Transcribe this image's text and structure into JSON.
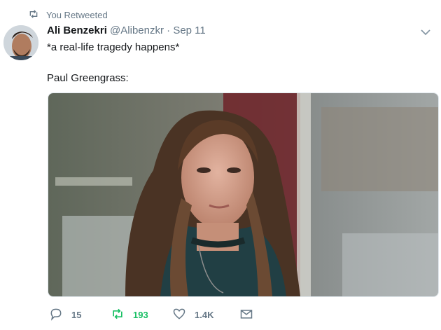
{
  "context": {
    "text": "You Retweeted"
  },
  "tweet": {
    "author_name": "Ali Benzekri",
    "handle": "@Alibenzkr",
    "separator": "·",
    "date": "Sep 11",
    "text_line1": "*a real-life tragedy happens*",
    "text_line2": "Paul Greengrass:"
  },
  "actions": {
    "reply_count": "15",
    "retweet_count": "193",
    "like_count": "1.4K"
  },
  "colors": {
    "retweet_active": "#17bf63",
    "secondary_text": "#657786"
  },
  "icons": [
    "retweet-icon",
    "chevron-down-icon",
    "reply-icon",
    "heart-icon",
    "envelope-icon"
  ]
}
